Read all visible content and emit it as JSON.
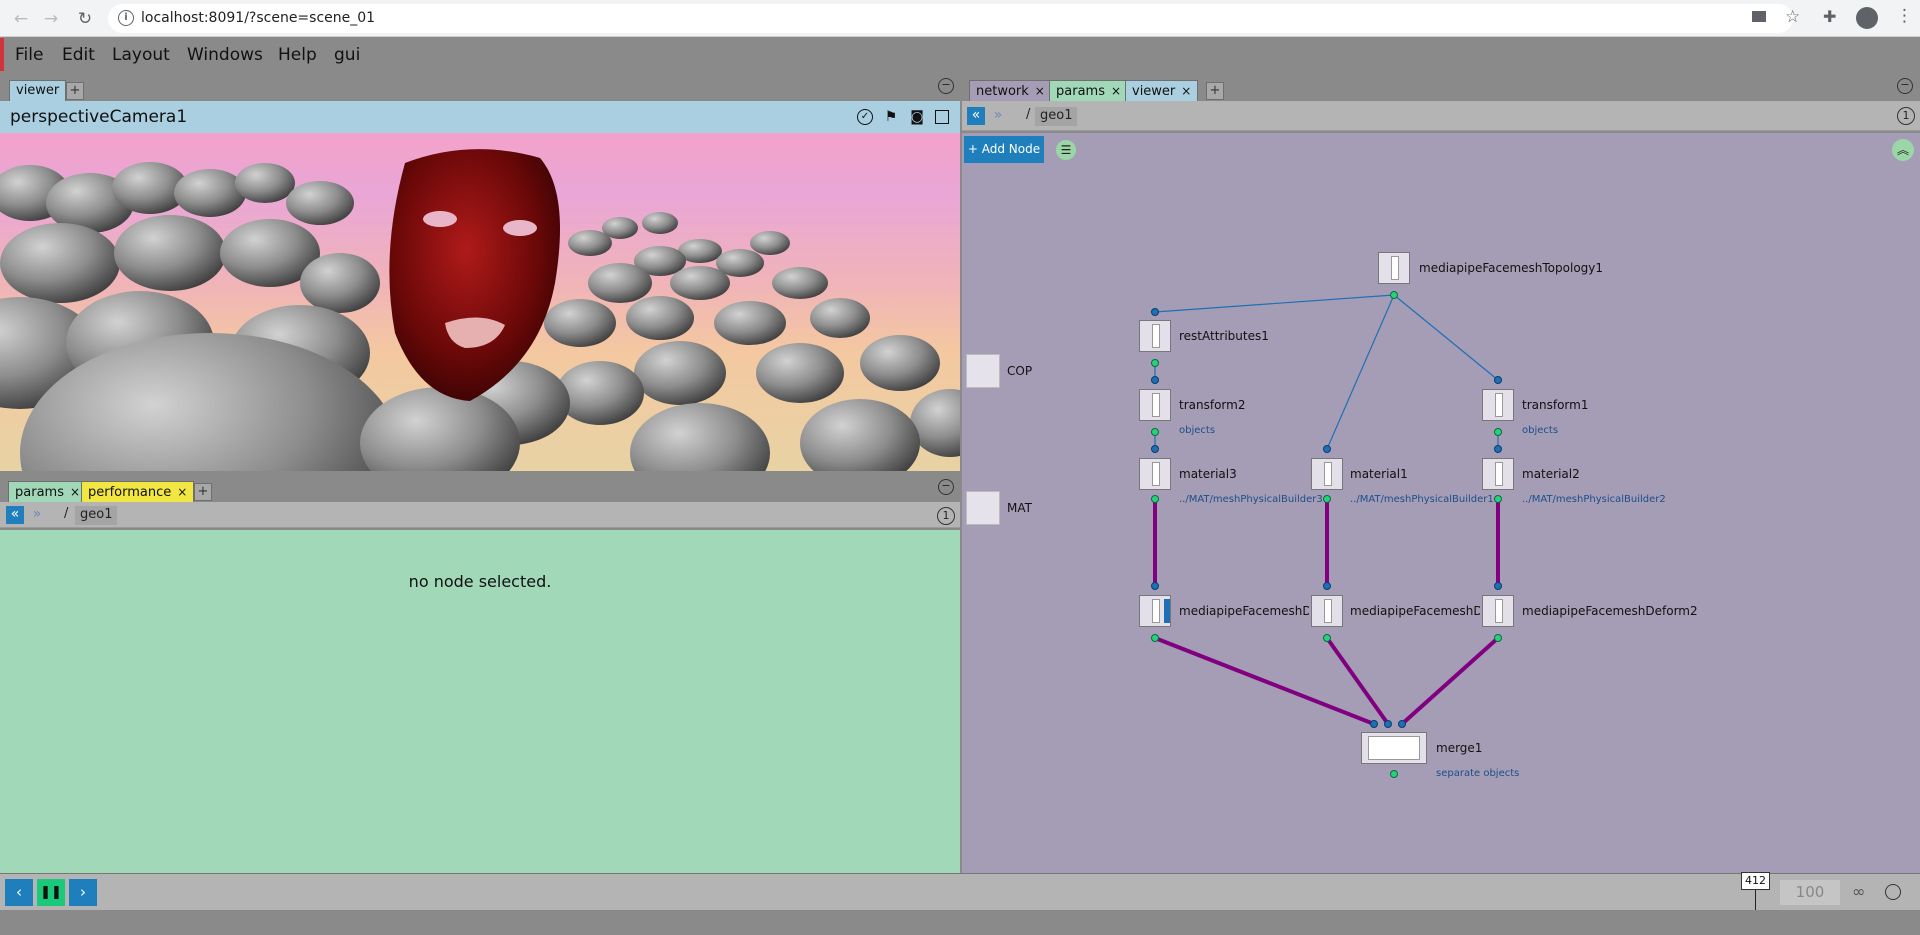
{
  "browser": {
    "url": "localhost:8091/?scene=scene_01",
    "back": "←",
    "forward": "→",
    "reload": "↻"
  },
  "menu": {
    "items": [
      "File",
      "Edit",
      "Layout",
      "Windows",
      "Help",
      "gui"
    ]
  },
  "viewer_panel": {
    "tabs": [
      {
        "label": "viewer"
      }
    ],
    "add": "+",
    "title": "perspectiveCamera1"
  },
  "params_panel": {
    "tabs": [
      {
        "label": "params",
        "close": "×"
      },
      {
        "label": "performance",
        "close": "×"
      }
    ],
    "add": "+",
    "path_root": "/",
    "path_seg": "geo1",
    "path_index": "1",
    "empty_message": "no node selected."
  },
  "network_panel": {
    "tabs": [
      {
        "label": "network",
        "close": "×"
      },
      {
        "label": "params",
        "close": "×"
      },
      {
        "label": "viewer",
        "close": "×"
      }
    ],
    "add": "+",
    "path_root": "/",
    "path_seg": "geo1",
    "path_index": "1",
    "add_node": "+ Add Node",
    "contexts": [
      "COP",
      "MAT"
    ],
    "nodes": [
      {
        "name": "mediapipeFacemeshTopology1",
        "sub": ""
      },
      {
        "name": "restAttributes1",
        "sub": ""
      },
      {
        "name": "transform2",
        "sub": "objects"
      },
      {
        "name": "transform1",
        "sub": "objects"
      },
      {
        "name": "material3",
        "sub": "../MAT/meshPhysicalBuilder3"
      },
      {
        "name": "material1",
        "sub": "../MAT/meshPhysicalBuilder1"
      },
      {
        "name": "material2",
        "sub": "../MAT/meshPhysicalBuilder2"
      },
      {
        "name": "mediapipeFacemeshDef",
        "sub": ""
      },
      {
        "name": "mediapipeFacemeshDef",
        "sub": ""
      },
      {
        "name": "mediapipeFacemeshDeform2",
        "sub": ""
      },
      {
        "name": "merge1",
        "sub": "separate objects"
      }
    ]
  },
  "timeline": {
    "current_frame": "412",
    "end_frame": "100",
    "progress": 0.913
  },
  "colors": {
    "accent_blue": "#1f7fbd",
    "play_green": "#1ac97a",
    "wire_purple": "#800080",
    "wire_blue": "#1f6fb5"
  }
}
